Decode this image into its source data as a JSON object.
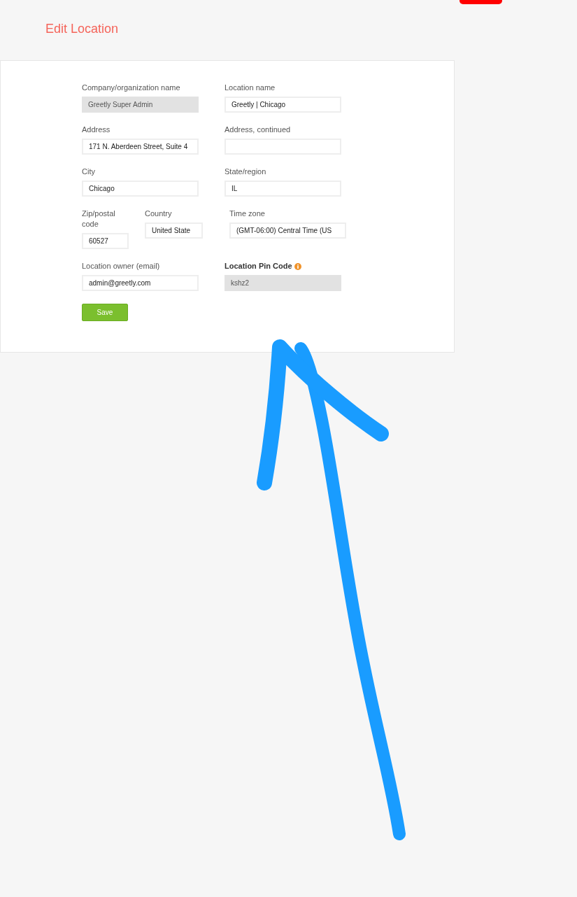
{
  "header": {
    "title": "Edit Location"
  },
  "rows": [
    {
      "fields": [
        {
          "kind": "text",
          "label": "Company/organization name",
          "value": "Greetly Super Admin",
          "disabled": true
        },
        {
          "kind": "text",
          "label": "Location name",
          "value": "Greetly | Chicago",
          "disabled": false
        }
      ]
    },
    {
      "fields": [
        {
          "kind": "text",
          "label": "Address",
          "value": "171 N. Aberdeen Street, Suite 4",
          "disabled": false
        },
        {
          "kind": "text",
          "label": "Address, continued",
          "disabled": false
        }
      ]
    },
    {
      "fields": [
        {
          "kind": "text",
          "label": "City",
          "value": "Chicago",
          "disabled": false
        },
        {
          "kind": "text",
          "label": "State/region",
          "value": "IL",
          "disabled": false
        }
      ]
    },
    {
      "fields": [
        {
          "kind": "text",
          "label": "Zip/postal code",
          "value": "60527",
          "disabled": false
        },
        {
          "kind": "text",
          "label": "Country",
          "value": "United State",
          "disabled": false
        },
        {
          "kind": "text",
          "label": "Time zone",
          "value": "(GMT-06:00) Central Time (US",
          "disabled": false
        }
      ]
    },
    {
      "fields": [
        {
          "kind": "text",
          "label": "Location owner (email)",
          "value": "admin@greetly.com",
          "disabled": false
        },
        {
          "kind": "pin",
          "label": "Location Pin Code",
          "value": "kshz2",
          "disabled": true
        }
      ]
    }
  ],
  "save_button": "Save"
}
